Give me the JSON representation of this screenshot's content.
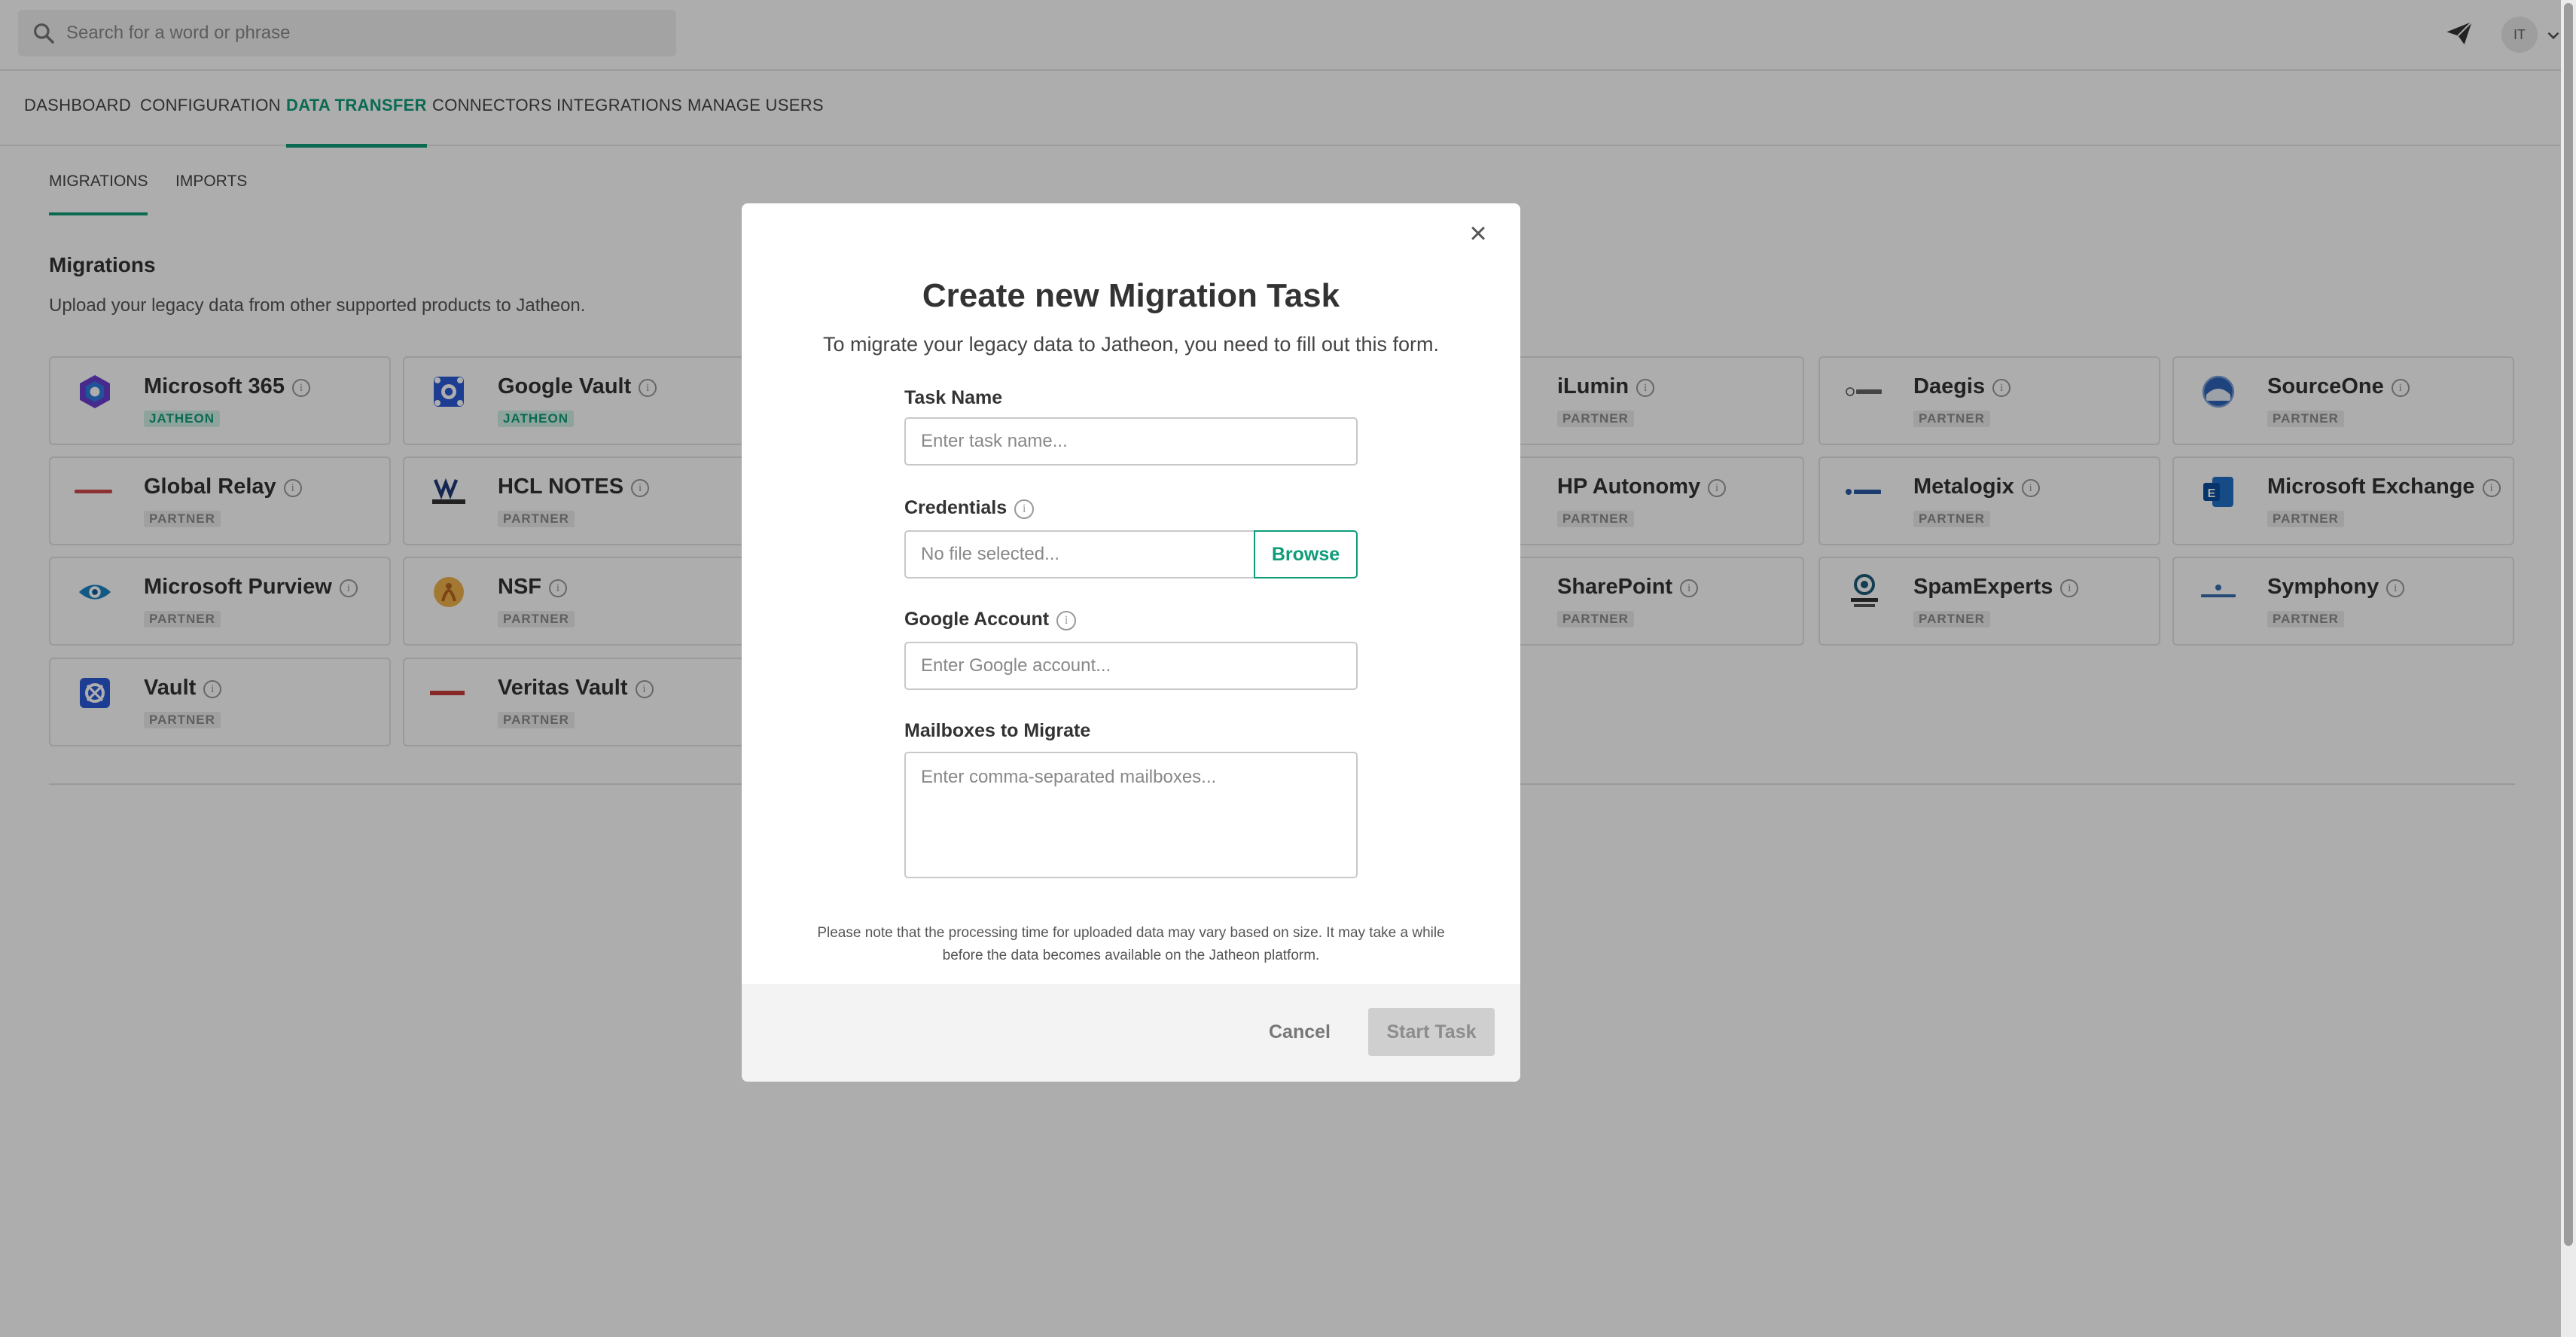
{
  "search": {
    "placeholder": "Search for a word or phrase"
  },
  "user": {
    "initials": "IT"
  },
  "nav": {
    "tabs": [
      {
        "label": "DASHBOARD"
      },
      {
        "label": "CONFIGURATION"
      },
      {
        "label": "DATA TRANSFER",
        "active": true
      },
      {
        "label": "CONNECTORS"
      },
      {
        "label": "INTEGRATIONS"
      },
      {
        "label": "MANAGE USERS"
      }
    ]
  },
  "subnav": {
    "tabs": [
      {
        "label": "MIGRATIONS",
        "active": true
      },
      {
        "label": "IMPORTS"
      }
    ]
  },
  "section": {
    "title": "Migrations",
    "subtitle": "Upload your legacy data from other supported products to Jatheon."
  },
  "cards": [
    {
      "name": "Microsoft 365",
      "badge": "JATHEON",
      "icon": "microsoft-365-logo"
    },
    {
      "name": "Google Vault",
      "badge": "JATHEON",
      "icon": "google-vault-logo"
    },
    {
      "name": "iLumin",
      "badge": "PARTNER",
      "icon": "ilumin-logo"
    },
    {
      "name": "Daegis",
      "badge": "PARTNER",
      "icon": "daegis-logo"
    },
    {
      "name": "SourceOne",
      "badge": "PARTNER",
      "icon": "sourceone-logo"
    },
    {
      "name": "Global Relay",
      "badge": "PARTNER",
      "icon": "global-relay-logo"
    },
    {
      "name": "HCL NOTES",
      "badge": "PARTNER",
      "icon": "hcl-notes-logo"
    },
    {
      "name": "HP Autonomy",
      "badge": "PARTNER",
      "icon": "hp-autonomy-logo"
    },
    {
      "name": "Metalogix",
      "badge": "PARTNER",
      "icon": "metalogix-logo"
    },
    {
      "name": "Microsoft Exchange",
      "badge": "PARTNER",
      "icon": "microsoft-exchange-logo"
    },
    {
      "name": "Microsoft Purview",
      "badge": "PARTNER",
      "icon": "microsoft-purview-logo"
    },
    {
      "name": "NSF",
      "badge": "PARTNER",
      "icon": "nsf-logo"
    },
    {
      "name": "SharePoint",
      "badge": "PARTNER",
      "icon": "sharepoint-logo"
    },
    {
      "name": "SpamExperts",
      "badge": "PARTNER",
      "icon": "spamexperts-logo"
    },
    {
      "name": "Symphony",
      "badge": "PARTNER",
      "icon": "symphony-logo"
    },
    {
      "name": "Vault",
      "badge": "PARTNER",
      "icon": "vault-logo"
    },
    {
      "name": "Veritas Vault",
      "badge": "PARTNER",
      "icon": "veritas-vault-logo"
    }
  ],
  "modal": {
    "title": "Create new Migration Task",
    "subtitle": "To migrate your legacy data to Jatheon, you need to fill out this form.",
    "task_name": {
      "label": "Task Name",
      "placeholder": "Enter task name..."
    },
    "credentials": {
      "label": "Credentials",
      "file_text": "No file selected...",
      "browse_label": "Browse"
    },
    "google_account": {
      "label": "Google Account",
      "placeholder": "Enter Google account..."
    },
    "mailboxes": {
      "label": "Mailboxes to Migrate",
      "placeholder": "Enter comma-separated mailboxes..."
    },
    "note_line1": "Please note that the processing time for uploaded data may vary based on size. It may take a while",
    "note_line2": "before the data becomes available on the Jatheon platform.",
    "cancel_label": "Cancel",
    "start_label": "Start Task"
  },
  "colors": {
    "accent": "#0f9c7a",
    "overlay": "rgba(0,0,0,0.32)"
  }
}
